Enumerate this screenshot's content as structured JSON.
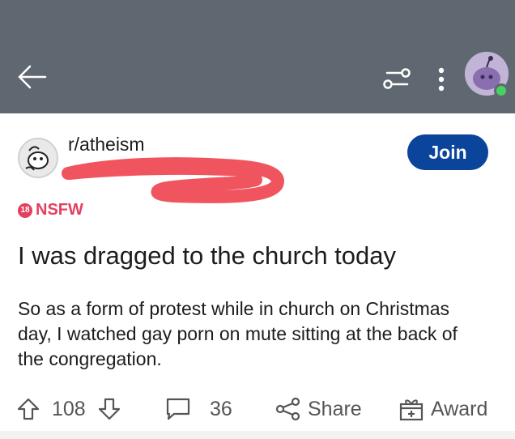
{
  "header": {
    "back_icon": "arrow-left-icon",
    "filter_icon": "sliders-icon",
    "more_icon": "more-vertical-icon",
    "colors": {
      "bar": "#5f6870",
      "online": "#46d160"
    }
  },
  "post": {
    "subreddit": "r/atheism",
    "join_label": "Join",
    "nsfw_badge": "18",
    "nsfw_label": "NSFW",
    "title": "I was dragged to the church today",
    "body": "So as a form of protest while in church on Christmas day, I watched gay porn on mute sitting at the back of the congregation.",
    "colors": {
      "join": "#0a449b",
      "nsfw": "#e2405f"
    }
  },
  "actions": {
    "upvotes": "108",
    "comments": "36",
    "share_label": "Share",
    "award_label": "Award"
  }
}
